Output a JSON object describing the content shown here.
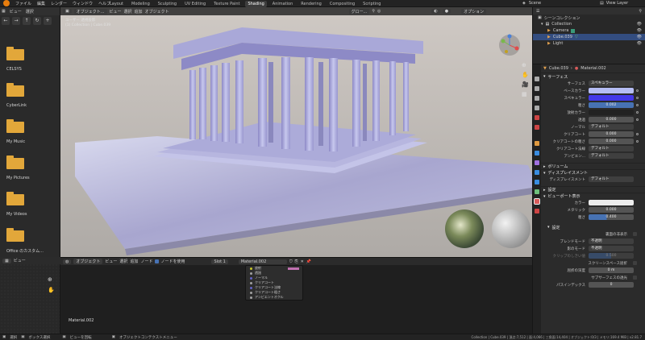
{
  "topbar": {
    "menus": [
      "ファイル",
      "編集",
      "レンダー",
      "ウィンドウ",
      "ヘルプ"
    ],
    "tabs": [
      "Layout",
      "Modeling",
      "Sculpting",
      "UV Editing",
      "Texture Paint",
      "Shading",
      "Animation",
      "Rendering",
      "Compositing",
      "Scripting"
    ],
    "active_tab": "Shading",
    "scene": "Scene",
    "view_layer": "View Layer"
  },
  "filebrowser": {
    "header_items": [
      "ビュー",
      "選択"
    ],
    "folders": [
      "CELSYS",
      "CyberLink",
      "My Music",
      "My Pictures",
      "My Videos",
      "Office のカスタム..."
    ]
  },
  "viewport": {
    "mode": "オブジェクト...",
    "menus": [
      "ビュー",
      "選択",
      "追加",
      "オブジェクト"
    ],
    "overlay_line1": "ユーザー 透視投影",
    "overlay_line2": "(1) Collection | Cube.039",
    "transform": "グロー...",
    "options": "オプション"
  },
  "node_editor": {
    "menus": [
      "オブジェクト",
      "ビュー",
      "選択",
      "追加",
      "ノード"
    ],
    "use_nodes": "ノードを使用",
    "slot": "Slot 1",
    "material": "Material.002",
    "material_label": "Material.002",
    "node_rows": [
      "放射",
      "透過",
      "ノーマル",
      "クリアコート",
      "クリアコート法線",
      "クリアコート粗さ",
      "アンビエントオクル"
    ]
  },
  "outliner": {
    "title": "シーンコレクション",
    "rows": [
      "Collection",
      "Camera",
      "Cube.039",
      "Light"
    ]
  },
  "properties": {
    "object": "Cube.039",
    "material": "Material.002",
    "surface_section": "サーフェス",
    "rows": [
      {
        "label": "サーフェス",
        "value": "スペキュラー",
        "kind": "field"
      },
      {
        "label": "ベースカラー",
        "value": "",
        "kind": "color",
        "color": "#b6bdf4"
      },
      {
        "label": "スペキュラー",
        "value": "",
        "kind": "color",
        "color": "#4438e8"
      },
      {
        "label": "粗さ",
        "value": "0.002",
        "kind": "slider"
      },
      {
        "label": "放射カラー",
        "value": "",
        "kind": "color",
        "color": "#222222"
      },
      {
        "label": "透過",
        "value": "0.000",
        "kind": "slider"
      },
      {
        "label": "ノーマル",
        "value": "デフォルト",
        "kind": "field"
      },
      {
        "label": "クリアコート",
        "value": "0.000",
        "kind": "slider"
      },
      {
        "label": "クリアコートの粗さ",
        "value": "0.000",
        "kind": "slider"
      },
      {
        "label": "クリアコート法線",
        "value": "デフォルト",
        "kind": "field"
      },
      {
        "label": "アンビエン...",
        "value": "デフォルト",
        "kind": "field"
      }
    ],
    "volume_section": "ボリューム",
    "displacement_section": "ディスプレイスメント",
    "displacement_row": {
      "label": "ディスプレイスメント",
      "value": "デフォルト"
    },
    "settings_section": "設定",
    "viewport_display_section": "ビューポート表示",
    "vp_rows": [
      {
        "label": "カラー",
        "value": "",
        "kind": "color",
        "color": "#ececec"
      },
      {
        "label": "メタリック",
        "value": "0.000",
        "kind": "slider"
      },
      {
        "label": "粗さ",
        "value": "0.400",
        "kind": "slider"
      }
    ],
    "settings_sub": "設定",
    "settings_rows": [
      {
        "label": "",
        "value": "裏面の非表示",
        "kind": "check"
      },
      {
        "label": "ブレンドモード",
        "value": "不透明",
        "kind": "field"
      },
      {
        "label": "影のモード",
        "value": "不透明",
        "kind": "field"
      },
      {
        "label": "クリップのしきい値",
        "value": "0.500",
        "kind": "slider"
      },
      {
        "label": "",
        "value": "スクリーンスペース屈折",
        "kind": "check"
      },
      {
        "label": "屈折の深度",
        "value": "0 m",
        "kind": "slider"
      },
      {
        "label": "",
        "value": "サブサーフェスの透光",
        "kind": "check"
      },
      {
        "label": "パスインデックス",
        "value": "0",
        "kind": "slider"
      }
    ]
  },
  "statusbar": {
    "items": [
      "選択",
      "ボックス選択",
      "ビューを回転",
      "オブジェクトコンテクストメニュー"
    ],
    "right": "Collection | Cube.039 | 頂点:7,512 | 面:4,066 | 三角面:14,404 | オブジェクト:0/3 | メモリ:169.4 MiB | v2.81.7"
  },
  "colors": {
    "accent": "#4772b3",
    "folder": "#e2a73a",
    "base_color": "#b6bdf4",
    "specular": "#4438e8"
  }
}
